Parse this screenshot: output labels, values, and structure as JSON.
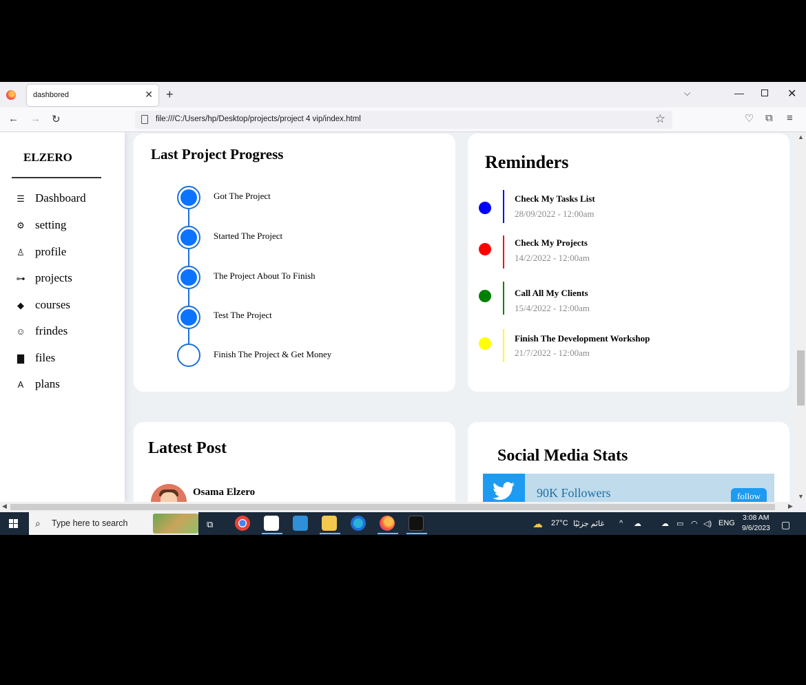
{
  "browser": {
    "tab_title": "dashbored",
    "url": "file:///C:/Users/hp/Desktop/projects/project 4 vip/index.html"
  },
  "sidebar": {
    "brand": "ELZERO",
    "items": [
      {
        "label": "Dashboard",
        "icon": "bars-icon"
      },
      {
        "label": "setting",
        "icon": "gear-icon"
      },
      {
        "label": "profile",
        "icon": "user-icon"
      },
      {
        "label": "projects",
        "icon": "sitemap-icon"
      },
      {
        "label": "courses",
        "icon": "graduation-cap-icon"
      },
      {
        "label": "frindes",
        "icon": "friends-icon"
      },
      {
        "label": "files",
        "icon": "file-icon"
      },
      {
        "label": "plans",
        "icon": "plans-icon"
      }
    ]
  },
  "progress": {
    "title": "Last Project Progress",
    "steps": [
      {
        "label": "Got The Project",
        "done": true
      },
      {
        "label": "Started The Project",
        "done": true
      },
      {
        "label": "The Project About To Finish",
        "done": true
      },
      {
        "label": "Test The Project",
        "done": true
      },
      {
        "label": "Finish The Project & Get Money",
        "done": false
      }
    ]
  },
  "reminders": {
    "title": "Reminders",
    "items": [
      {
        "title": "Check My Tasks List",
        "date": "28/09/2022 - 12:00am",
        "color": "#0000ff"
      },
      {
        "title": "Check My Projects",
        "date": "14/2/2022 - 12:00am",
        "color": "#ff0000"
      },
      {
        "title": "Call All My Clients",
        "date": "15/4/2022 - 12:00am",
        "color": "#008000"
      },
      {
        "title": "Finish The Development Workshop",
        "date": "21/7/2022 - 12:00am",
        "color": "#ffff00"
      }
    ]
  },
  "latest_post": {
    "title": "Latest Post",
    "author": "Osama Elzero"
  },
  "social": {
    "title": "Social Media Stats",
    "twitter_followers": "90K Followers",
    "follow_label": "follow"
  },
  "taskbar": {
    "search_placeholder": "Type here to search",
    "weather_temp": "27°C",
    "weather_text": "غائم جزئيًا",
    "language": "ENG",
    "time": "3:08 AM",
    "date": "9/6/2023"
  }
}
